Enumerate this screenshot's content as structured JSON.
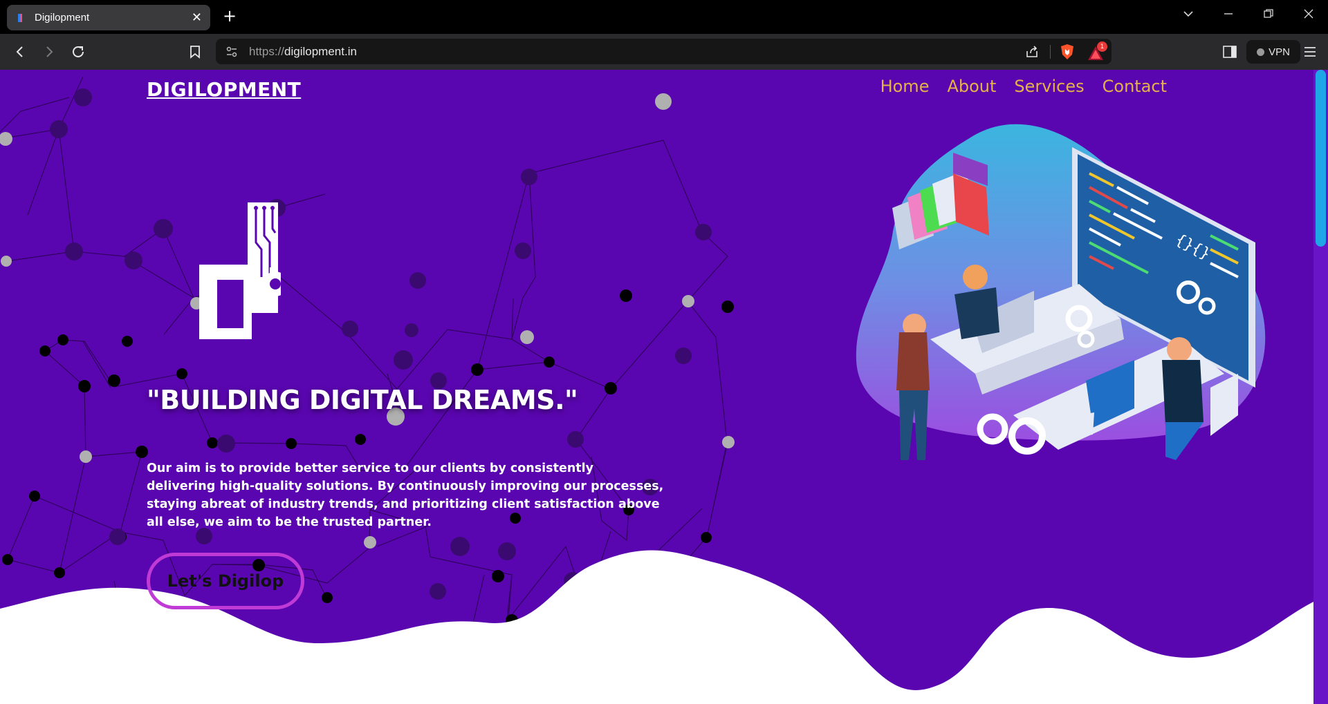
{
  "browser": {
    "tab_title": "Digilopment",
    "tab_close": "✕",
    "new_tab": "+",
    "url_prefix": "https://",
    "url_host": "digilopment.in",
    "vpn_label": "VPN",
    "notification_count": "1",
    "icons": [
      "back-icon",
      "forward-icon",
      "reload-icon",
      "bookmark-icon",
      "site-info-icon",
      "share-icon",
      "brave-shield-icon",
      "brave-rewards-icon",
      "sidebar-icon",
      "menu-icon"
    ]
  },
  "site": {
    "brand": "DIGILOPMENT",
    "nav": [
      {
        "label": "Home"
      },
      {
        "label": "About"
      },
      {
        "label": "Services"
      },
      {
        "label": "Contact"
      }
    ],
    "headline": "\"BUILDING DIGITAL DREAMS.\"",
    "description": "Our aim is to provide better service to our clients by consistently delivering high-quality solutions. By continuously improving our processes, staying abreat of industry trends, and prioritizing client satisfaction above all else, we aim to be the trusted partner.",
    "cta_label": "Let's Digilop"
  },
  "colors": {
    "hero_bg": "#5a06b0",
    "nav_link": "#e7b14a",
    "cta_border": "#c03ad6",
    "scroll_thumb": "#1fa6e6"
  }
}
